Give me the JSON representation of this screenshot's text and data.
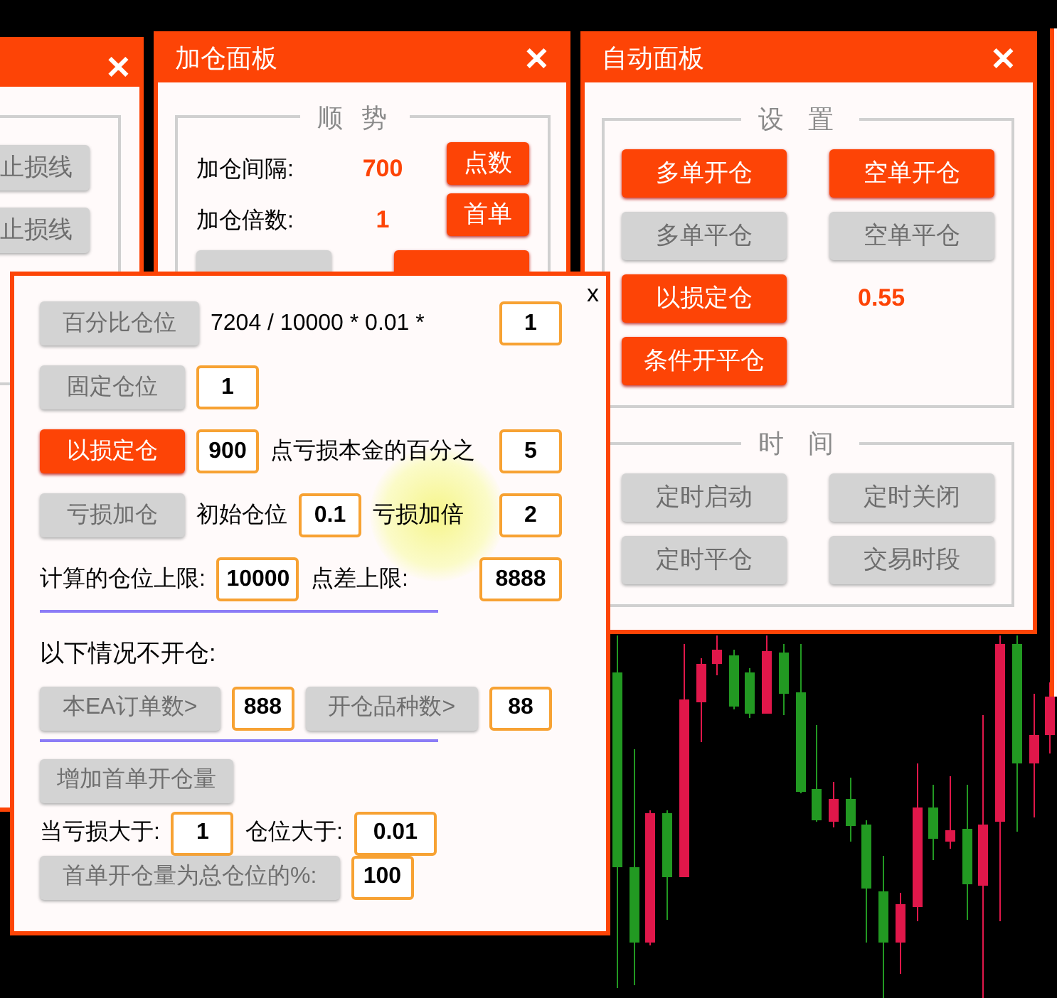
{
  "left_panel": {
    "close": "✕",
    "buttons": [
      {
        "label": "止损线",
        "disabled": true
      },
      {
        "label": "止损线",
        "disabled": true
      }
    ]
  },
  "add_panel": {
    "title": "加仓面板",
    "close": "✕",
    "legend": "顺 势",
    "rows": [
      {
        "label": "加仓间隔:",
        "value": "700",
        "button": {
          "label": "点数",
          "disabled": false
        }
      },
      {
        "label": "加仓倍数:",
        "value": "1",
        "button": {
          "label": "首单",
          "disabled": false
        }
      }
    ],
    "bottom_buttons": [
      {
        "disabled": true
      },
      {
        "disabled": false
      }
    ]
  },
  "auto_panel": {
    "title": "自动面板",
    "close": "✕",
    "groups": [
      {
        "legend": "设 置",
        "items": [
          {
            "kind": "button",
            "label": "多单开仓",
            "disabled": false
          },
          {
            "kind": "button",
            "label": "空单开仓",
            "disabled": false
          },
          {
            "kind": "button",
            "label": "多单平仓",
            "disabled": true
          },
          {
            "kind": "button",
            "label": "空单平仓",
            "disabled": true
          },
          {
            "kind": "button",
            "label": "以损定仓",
            "disabled": false
          },
          {
            "kind": "value",
            "text": "0.55"
          },
          {
            "kind": "button",
            "label": "条件开平仓",
            "disabled": false
          }
        ]
      },
      {
        "legend": "时 间",
        "items": [
          {
            "kind": "button",
            "label": "定时启动",
            "disabled": true
          },
          {
            "kind": "button",
            "label": "定时关闭",
            "disabled": true
          },
          {
            "kind": "button",
            "label": "定时平仓",
            "disabled": true
          },
          {
            "kind": "button",
            "label": "交易时段",
            "disabled": true
          }
        ]
      }
    ]
  },
  "dialog": {
    "close": "x",
    "sections": [
      {
        "divider": false,
        "rows": [
          [
            {
              "kind": "button",
              "label": "百分比仓位",
              "disabled": true
            },
            {
              "kind": "text",
              "text": "7204 / 10000 * 0.01 *"
            },
            "",
            {
              "kind": "input",
              "value": "1"
            }
          ],
          [
            {
              "kind": "button",
              "label": "固定仓位",
              "disabled": true
            },
            {
              "kind": "input",
              "value": "1"
            }
          ],
          [
            {
              "kind": "button",
              "label": "以损定仓",
              "disabled": false
            },
            {
              "kind": "input",
              "value": "900"
            },
            {
              "kind": "text",
              "text": "点亏损本金的百分之"
            },
            {
              "kind": "input",
              "value": "5"
            }
          ],
          [
            {
              "kind": "button",
              "label": "亏损加仓",
              "disabled": true
            },
            {
              "kind": "text",
              "text": "初始仓位"
            },
            {
              "kind": "input",
              "value": "0.1"
            },
            {
              "kind": "text",
              "text": "亏损加倍"
            },
            {
              "kind": "input",
              "value": "2"
            }
          ],
          [
            {
              "kind": "text",
              "text": "计算的仓位上限:"
            },
            {
              "kind": "input",
              "value": "10000"
            },
            {
              "kind": "text",
              "text": "点差上限:"
            },
            {
              "kind": "input",
              "value": "8888"
            }
          ]
        ]
      },
      {
        "divider": true,
        "heading": "以下情况不开仓:",
        "rows": [
          [
            {
              "kind": "button",
              "label": "本EA订单数>",
              "disabled": true
            },
            {
              "kind": "input",
              "value": "888"
            },
            {
              "kind": "button",
              "label": "开仓品种数>",
              "disabled": true
            },
            {
              "kind": "input",
              "value": "88"
            }
          ]
        ]
      },
      {
        "divider": true,
        "button": {
          "label": "增加首单开仓量",
          "disabled": true
        },
        "rows": [
          [
            {
              "kind": "text",
              "text": "当亏损大于:"
            },
            {
              "kind": "input",
              "value": "1"
            },
            {
              "kind": "text",
              "text": "仓位大于:"
            },
            {
              "kind": "input",
              "value": "0.01"
            }
          ]
        ]
      },
      {
        "divider": false,
        "rows": [
          [
            {
              "kind": "button",
              "label": "首单开仓量为总仓位的%:",
              "disabled": true
            },
            {
              "kind": "input",
              "value": "100"
            }
          ]
        ]
      }
    ]
  }
}
